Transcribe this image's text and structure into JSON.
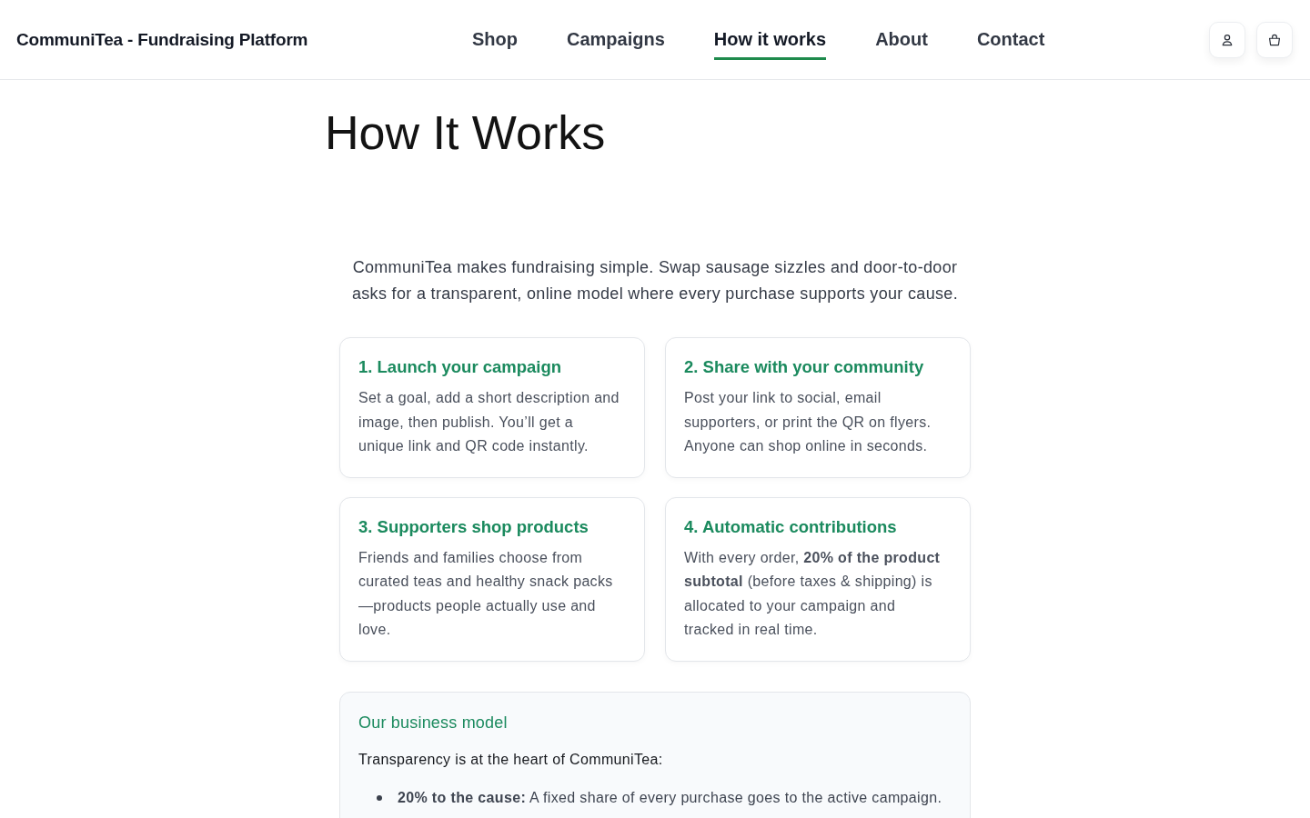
{
  "header": {
    "brand": "CommuniTea - Fundraising Platform",
    "nav": [
      {
        "label": "Shop",
        "selected": false
      },
      {
        "label": "Campaigns",
        "selected": false
      },
      {
        "label": "How it works",
        "selected": true
      },
      {
        "label": "About",
        "selected": false
      },
      {
        "label": "Contact",
        "selected": false
      }
    ]
  },
  "page": {
    "title": "How It Works",
    "intro": "CommuniTea makes fundraising simple. Swap sausage sizzles and door-to-door asks for a transparent, online model where every purchase supports your cause.",
    "steps": [
      {
        "title": "1. Launch your campaign",
        "body": "Set a goal, add a short description and image, then publish. You’ll get a unique link and QR code instantly."
      },
      {
        "title": "2. Share with your community",
        "body": "Post your link to social, email supporters, or print the QR on flyers. Anyone can shop online in seconds."
      },
      {
        "title": "3. Supporters shop products",
        "body": "Friends and families choose from curated teas and healthy snack packs—products people actually use and love."
      },
      {
        "title": "4. Automatic contributions",
        "body": "With every order, **20% of the product subtotal** (before taxes & shipping) is allocated to your campaign and tracked in real time."
      }
    ],
    "business_model": {
      "title": "Our business model",
      "lead": "Transparency is at the heart of CommuniTea:",
      "points": [
        "**20% to the cause:** A fixed share of every purchase goes to the active campaign."
      ]
    }
  }
}
